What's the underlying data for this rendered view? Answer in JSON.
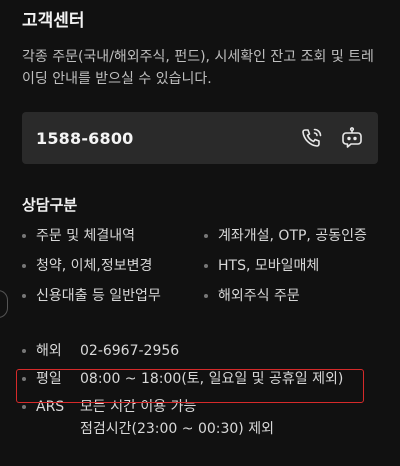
{
  "header": {
    "title": "고객센터"
  },
  "description": "각종 주문(국내/해외주식, 펀드), 시세확인 잔고 조회 및 트레이딩 안내를 받으실 수 있습니다.",
  "phone_card": {
    "number": "1588-6800",
    "call_icon": "phone-call-icon",
    "chat_icon": "chatbot-icon"
  },
  "consult": {
    "title": "상담구분",
    "items": [
      "주문 및 체결내역",
      "계좌개설, OTP, 공동인증",
      "청약, 이체,정보변경",
      "HTS, 모바일매체",
      "신용대출 등 일반업무",
      "해외주식 주문"
    ]
  },
  "hours": [
    {
      "label": "해외",
      "value": "02-6967-2956"
    },
    {
      "label": "평일",
      "value": "08:00 ~ 18:00(토, 일요일 및 공휴일 제외)"
    },
    {
      "label": "ARS",
      "value": "모든 시간 이용 가능",
      "value2": "점검시간(23:00 ~ 00:30) 제외"
    }
  ],
  "colors": {
    "background": "#111111",
    "card": "#2a2a2a",
    "highlight": "#d62a2a"
  }
}
